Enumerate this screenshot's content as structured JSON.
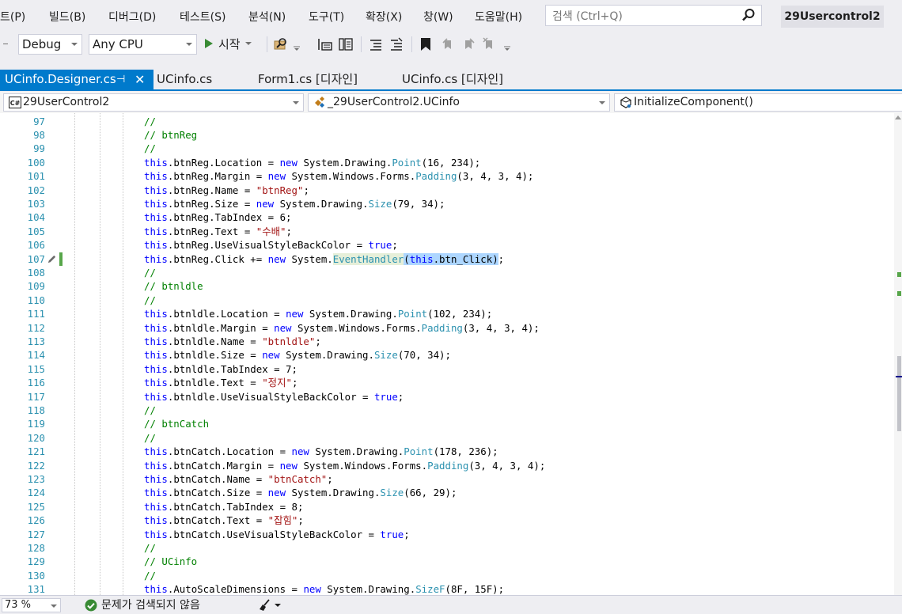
{
  "menu": {
    "items": [
      "트(P)",
      "빌드(B)",
      "디버그(D)",
      "테스트(S)",
      "분석(N)",
      "도구(T)",
      "확장(X)",
      "창(W)",
      "도움말(H)"
    ]
  },
  "search": {
    "placeholder": "검색 (Ctrl+Q)"
  },
  "solution_name": "29Usercontrol2",
  "toolbar": {
    "config": "Debug",
    "platform": "Any CPU",
    "start_label": "시작"
  },
  "tabs": [
    {
      "label": "UCinfo.Designer.cs",
      "active": true,
      "pin": "⊣",
      "close": "✕"
    },
    {
      "label": "UCinfo.cs"
    },
    {
      "label": "Form1.cs [디자인]"
    },
    {
      "label": "UCinfo.cs [디자인]"
    }
  ],
  "navbar": {
    "project": "29UserControl2",
    "project_icon": "C#",
    "type": "_29UserControl2.UCinfo",
    "member": "InitializeComponent()"
  },
  "code": {
    "line_numbers": [
      "97",
      "98",
      "99",
      "100",
      "101",
      "102",
      "103",
      "104",
      "105",
      "106",
      "107",
      "108",
      "109",
      "110",
      "111",
      "112",
      "113",
      "114",
      "115",
      "116",
      "117",
      "118",
      "119",
      "120",
      "121",
      "122",
      "123",
      "124",
      "125",
      "126",
      "127",
      "128",
      "129",
      "130",
      "131"
    ],
    "lines": [
      [
        [
          "cm",
          "//"
        ]
      ],
      [
        [
          "cm",
          "// btnReg"
        ]
      ],
      [
        [
          "cm",
          "//"
        ]
      ],
      [
        [
          "kw",
          "this"
        ],
        [
          "",
          "."
        ],
        [
          "",
          "btnReg.Location = "
        ],
        [
          "kw",
          "new"
        ],
        [
          "",
          " System.Drawing."
        ],
        [
          "ty",
          "Point"
        ],
        [
          "",
          "(16, 234);"
        ]
      ],
      [
        [
          "kw",
          "this"
        ],
        [
          "",
          "."
        ],
        [
          "",
          "btnReg.Margin = "
        ],
        [
          "kw",
          "new"
        ],
        [
          "",
          " System.Windows.Forms."
        ],
        [
          "ty",
          "Padding"
        ],
        [
          "",
          "(3, 4, 3, 4);"
        ]
      ],
      [
        [
          "kw",
          "this"
        ],
        [
          "",
          "."
        ],
        [
          "",
          "btnReg.Name = "
        ],
        [
          "str",
          "\"btnReg\""
        ],
        [
          "",
          ";"
        ]
      ],
      [
        [
          "kw",
          "this"
        ],
        [
          "",
          "."
        ],
        [
          "",
          "btnReg.Size = "
        ],
        [
          "kw",
          "new"
        ],
        [
          "",
          " System.Drawing."
        ],
        [
          "ty",
          "Size"
        ],
        [
          "",
          "(79, 34);"
        ]
      ],
      [
        [
          "kw",
          "this"
        ],
        [
          "",
          "."
        ],
        [
          "",
          "btnReg.TabIndex = 6;"
        ]
      ],
      [
        [
          "kw",
          "this"
        ],
        [
          "",
          "."
        ],
        [
          "",
          "btnReg.Text = "
        ],
        [
          "str",
          "\"수배\""
        ],
        [
          "",
          ";"
        ]
      ],
      [
        [
          "kw",
          "this"
        ],
        [
          "",
          "."
        ],
        [
          "",
          "btnReg.UseVisualStyleBackColor = "
        ],
        [
          "kw",
          "true"
        ],
        [
          "",
          ";"
        ]
      ],
      [
        [
          "kw",
          "this"
        ],
        [
          "",
          "."
        ],
        [
          "",
          "btnReg.Click += "
        ],
        [
          "kw",
          "new"
        ],
        [
          "",
          " System."
        ],
        [
          "hlty",
          "EventHandler"
        ],
        [
          "sel",
          "("
        ],
        [
          "selkw",
          "this"
        ],
        [
          "sel",
          ".btn_Click)"
        ],
        [
          "",
          ";"
        ]
      ],
      [
        [
          "cm",
          "//"
        ]
      ],
      [
        [
          "cm",
          "// btnldle"
        ]
      ],
      [
        [
          "cm",
          "//"
        ]
      ],
      [
        [
          "kw",
          "this"
        ],
        [
          "",
          "."
        ],
        [
          "",
          "btnldle.Location = "
        ],
        [
          "kw",
          "new"
        ],
        [
          "",
          " System.Drawing."
        ],
        [
          "ty",
          "Point"
        ],
        [
          "",
          "(102, 234);"
        ]
      ],
      [
        [
          "kw",
          "this"
        ],
        [
          "",
          "."
        ],
        [
          "",
          "btnldle.Margin = "
        ],
        [
          "kw",
          "new"
        ],
        [
          "",
          " System.Windows.Forms."
        ],
        [
          "ty",
          "Padding"
        ],
        [
          "",
          "(3, 4, 3, 4);"
        ]
      ],
      [
        [
          "kw",
          "this"
        ],
        [
          "",
          "."
        ],
        [
          "",
          "btnldle.Name = "
        ],
        [
          "str",
          "\"btnldle\""
        ],
        [
          "",
          ";"
        ]
      ],
      [
        [
          "kw",
          "this"
        ],
        [
          "",
          "."
        ],
        [
          "",
          "btnldle.Size = "
        ],
        [
          "kw",
          "new"
        ],
        [
          "",
          " System.Drawing."
        ],
        [
          "ty",
          "Size"
        ],
        [
          "",
          "(70, 34);"
        ]
      ],
      [
        [
          "kw",
          "this"
        ],
        [
          "",
          "."
        ],
        [
          "",
          "btnldle.TabIndex = 7;"
        ]
      ],
      [
        [
          "kw",
          "this"
        ],
        [
          "",
          "."
        ],
        [
          "",
          "btnldle.Text = "
        ],
        [
          "str",
          "\"정지\""
        ],
        [
          "",
          ";"
        ]
      ],
      [
        [
          "kw",
          "this"
        ],
        [
          "",
          "."
        ],
        [
          "",
          "btnldle.UseVisualStyleBackColor = "
        ],
        [
          "kw",
          "true"
        ],
        [
          "",
          ";"
        ]
      ],
      [
        [
          "cm",
          "//"
        ]
      ],
      [
        [
          "cm",
          "// btnCatch"
        ]
      ],
      [
        [
          "cm",
          "//"
        ]
      ],
      [
        [
          "kw",
          "this"
        ],
        [
          "",
          "."
        ],
        [
          "",
          "btnCatch.Location = "
        ],
        [
          "kw",
          "new"
        ],
        [
          "",
          " System.Drawing."
        ],
        [
          "ty",
          "Point"
        ],
        [
          "",
          "(178, 236);"
        ]
      ],
      [
        [
          "kw",
          "this"
        ],
        [
          "",
          "."
        ],
        [
          "",
          "btnCatch.Margin = "
        ],
        [
          "kw",
          "new"
        ],
        [
          "",
          " System.Windows.Forms."
        ],
        [
          "ty",
          "Padding"
        ],
        [
          "",
          "(3, 4, 3, 4);"
        ]
      ],
      [
        [
          "kw",
          "this"
        ],
        [
          "",
          "."
        ],
        [
          "",
          "btnCatch.Name = "
        ],
        [
          "str",
          "\"btnCatch\""
        ],
        [
          "",
          ";"
        ]
      ],
      [
        [
          "kw",
          "this"
        ],
        [
          "",
          "."
        ],
        [
          "",
          "btnCatch.Size = "
        ],
        [
          "kw",
          "new"
        ],
        [
          "",
          " System.Drawing."
        ],
        [
          "ty",
          "Size"
        ],
        [
          "",
          "(66, 29);"
        ]
      ],
      [
        [
          "kw",
          "this"
        ],
        [
          "",
          "."
        ],
        [
          "",
          "btnCatch.TabIndex = 8;"
        ]
      ],
      [
        [
          "kw",
          "this"
        ],
        [
          "",
          "."
        ],
        [
          "",
          "btnCatch.Text = "
        ],
        [
          "str",
          "\"잡힘\""
        ],
        [
          "",
          ";"
        ]
      ],
      [
        [
          "kw",
          "this"
        ],
        [
          "",
          "."
        ],
        [
          "",
          "btnCatch.UseVisualStyleBackColor = "
        ],
        [
          "kw",
          "true"
        ],
        [
          "",
          ";"
        ]
      ],
      [
        [
          "cm",
          "//"
        ]
      ],
      [
        [
          "cm",
          "// UCinfo"
        ]
      ],
      [
        [
          "cm",
          "//"
        ]
      ],
      [
        [
          "kw",
          "this"
        ],
        [
          "",
          "."
        ],
        [
          "",
          "AutoScaleDimensions = "
        ],
        [
          "kw",
          "new"
        ],
        [
          "",
          " System.Drawing."
        ],
        [
          "ty",
          "SizeF"
        ],
        [
          "",
          "(8F, 15F);"
        ]
      ]
    ],
    "edited_line": "107"
  },
  "status": {
    "zoom": "73 %",
    "message": "문제가 검색되지 않음"
  },
  "colors": {
    "accent": "#007acc",
    "keyword": "#0000ff",
    "type": "#2b91af",
    "string": "#a31515",
    "comment": "#008000",
    "change_bar": "#57a64a"
  }
}
